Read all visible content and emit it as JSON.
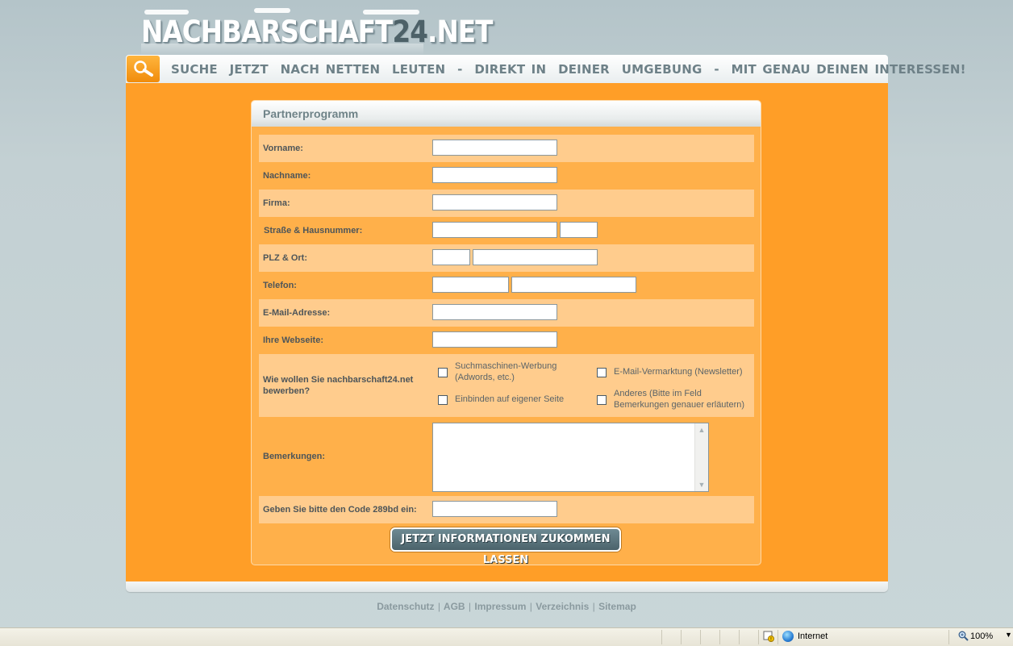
{
  "logo": {
    "part1": "NACHBARSCHAFT",
    "part2": "24",
    "part3": ".NET"
  },
  "banner": {
    "slogan": "SUCHE  JETZT  NACH NETTEN  LEUTEN  -  DIREKT IN  DEINER  UMGEBUNG  -  MIT GENAU DEINEN INTERESSEN!"
  },
  "panel": {
    "title": "Partnerprogramm",
    "fields": {
      "vorname": "Vorname:",
      "nachname": "Nachname:",
      "firma": "Firma:",
      "strasse": "Straße & Hausnummer:",
      "plz": "PLZ & Ort:",
      "telefon": "Telefon:",
      "email": "E-Mail-Adresse:",
      "webseite": "Ihre Webseite:",
      "bewerben": "Wie wollen Sie nachbarschaft24.net bewerben?",
      "bemerkungen": "Bemerkungen:",
      "code": "Geben Sie bitte den Code 289bd ein:"
    },
    "options": {
      "suchmaschinen": "Suchmaschinen-Werbung (Adwords, etc.)",
      "email_vermarktung": "E-Mail-Vermarktung (Newsletter)",
      "einbinden": "Einbinden auf eigener Seite",
      "anderes": "Anderes (Bitte im Feld Bemerkungen genauer erläutern)"
    },
    "submit_label": "JETZT INFORMATIONEN ZUKOMMEN LASSEN"
  },
  "footer": {
    "links": [
      "Datenschutz",
      "AGB",
      "Impressum",
      "Verzeichnis",
      "Sitemap"
    ],
    "separator": "|"
  },
  "statusbar": {
    "zone": "Internet",
    "zoom": "100%"
  },
  "colors": {
    "orange_main": "#ff9e27",
    "panel_bg": "#ffb04a",
    "row_light": "#ffcc8d",
    "slate": "#6e8188"
  }
}
